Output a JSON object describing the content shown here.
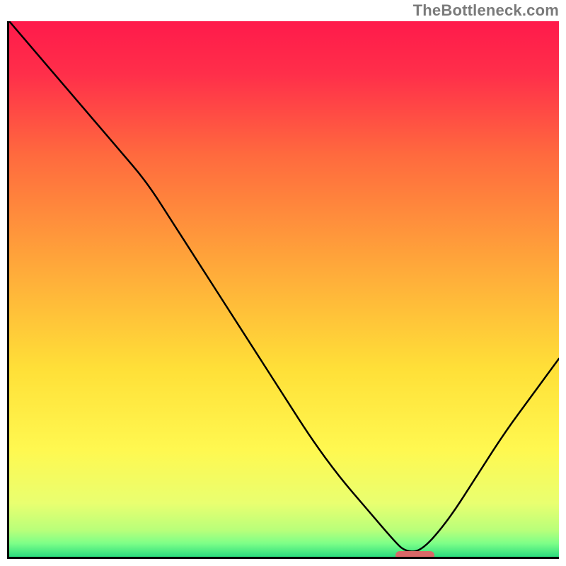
{
  "watermark_text": "TheBottleneck.com",
  "chart_data": {
    "type": "line",
    "title": "",
    "xlabel": "",
    "ylabel": "",
    "xlim": [
      0,
      100
    ],
    "ylim": [
      0,
      100
    ],
    "series": [
      {
        "name": "bottleneck-curve",
        "x": [
          0,
          5,
          10,
          15,
          20,
          25,
          30,
          35,
          40,
          45,
          50,
          55,
          60,
          65,
          70,
          72,
          75,
          80,
          85,
          90,
          95,
          100
        ],
        "values": [
          100,
          94,
          88,
          82,
          76,
          70,
          62,
          54,
          46,
          38,
          30,
          22,
          15,
          9,
          3,
          1,
          1,
          7,
          15,
          23,
          30,
          37
        ]
      }
    ],
    "marker": {
      "x_start": 70,
      "x_end": 77,
      "y": 0.7,
      "color": "#d96868"
    },
    "background_gradient": {
      "stops": [
        {
          "offset": 0.0,
          "color": "#ff1a4b"
        },
        {
          "offset": 0.1,
          "color": "#ff2f4a"
        },
        {
          "offset": 0.25,
          "color": "#ff6a3e"
        },
        {
          "offset": 0.45,
          "color": "#ffa63a"
        },
        {
          "offset": 0.65,
          "color": "#ffe038"
        },
        {
          "offset": 0.8,
          "color": "#fff850"
        },
        {
          "offset": 0.9,
          "color": "#e9ff70"
        },
        {
          "offset": 0.95,
          "color": "#b9ff7a"
        },
        {
          "offset": 0.975,
          "color": "#7dff88"
        },
        {
          "offset": 1.0,
          "color": "#2bdc7e"
        }
      ]
    }
  }
}
